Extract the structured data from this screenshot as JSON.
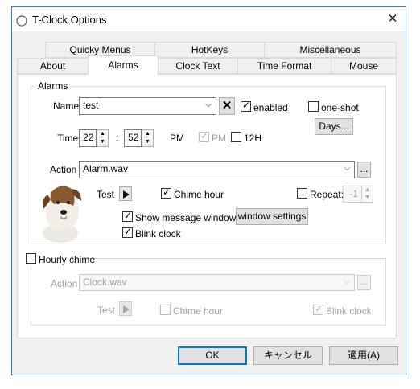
{
  "window": {
    "title": "T-Clock Options",
    "close_glyph": "✕"
  },
  "tabs_row1": [
    "Quicky Menus",
    "HotKeys",
    "Miscellaneous"
  ],
  "tabs_row2": [
    "About",
    "Alarms",
    "Clock Text",
    "Time Format",
    "Mouse"
  ],
  "alarms": {
    "group_label": "Alarms",
    "name_label": "Name",
    "name_value": "test",
    "delete_glyph": "✕",
    "enabled_label": "enabled",
    "oneshot_label": "one-shot",
    "days_button": "Days...",
    "time_label": "Time",
    "hour": "22",
    "minute": "52",
    "colon": ":",
    "ampm": "PM",
    "pm_label": "PM",
    "h12_label": "12H",
    "action_label": "Action",
    "action_value": "Alarm.wav",
    "browse_button": "...",
    "test_label": "Test",
    "chime_label": "Chime hour",
    "repeat_label": "Repeat:",
    "repeat_value": "-1",
    "show_message_label": "Show message window",
    "window_settings_button": "window settings",
    "blink_label": "Blink clock"
  },
  "hourly": {
    "group_label": "Hourly chime",
    "action_label": "Action",
    "action_value": "Clock.wav",
    "browse_button": "...",
    "test_label": "Test",
    "chime_label": "Chime hour",
    "blink_label": "Blink clock"
  },
  "buttons": {
    "ok": "OK",
    "cancel": "キャンセル",
    "apply": "適用(A)"
  },
  "icons": {
    "app": "clock-circle-icon",
    "close": "close-icon",
    "delete": "delete-x-icon",
    "play": "play-triangle-icon",
    "dropdown": "chevron-down-icon",
    "spin": "spin-up-down-icon",
    "dog": "dog-image"
  },
  "colors": {
    "accent": "#0078d7",
    "title_border": "#2b7fd4"
  }
}
